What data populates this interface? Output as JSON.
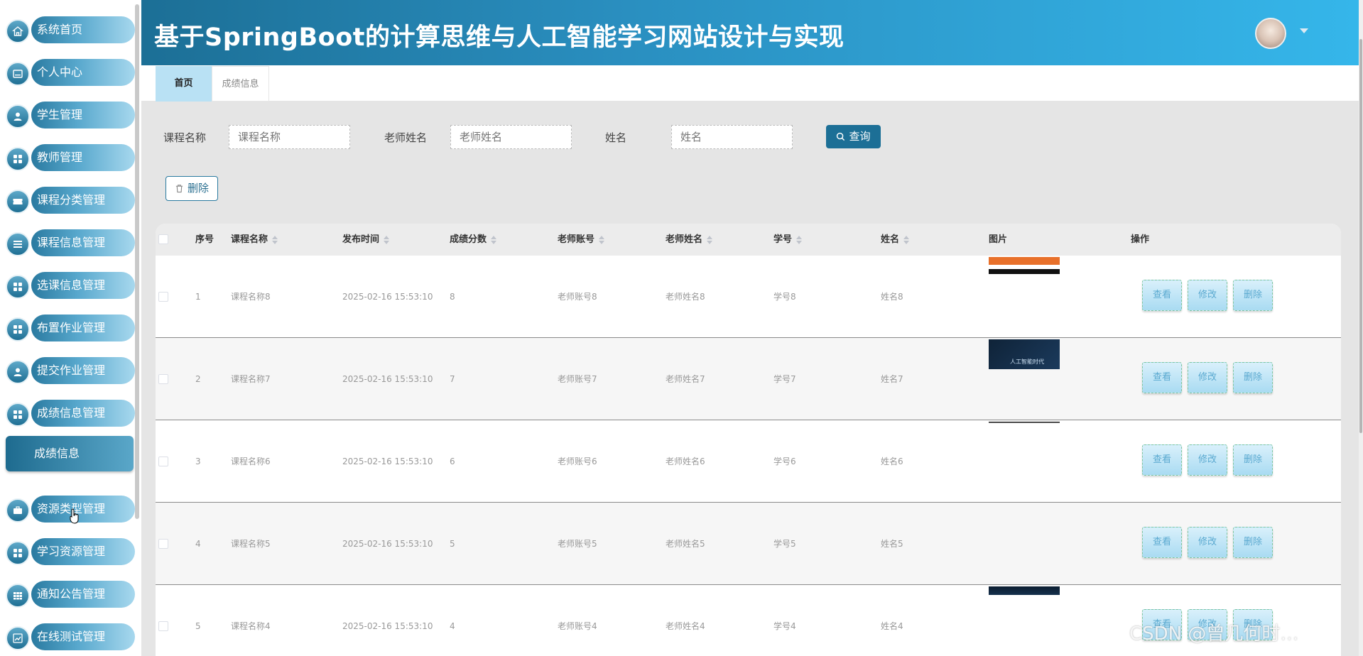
{
  "header": {
    "title": "基于SpringBoot的计算思维与人工智能学习网站设计与实现"
  },
  "sidebar": {
    "items": [
      {
        "label": "系统首页",
        "icon": "home-icon"
      },
      {
        "label": "个人中心",
        "icon": "id-card-icon"
      },
      {
        "label": "学生管理",
        "icon": "user-icon"
      },
      {
        "label": "教师管理",
        "icon": "grid-icon"
      },
      {
        "label": "课程分类管理",
        "icon": "ticket-icon"
      },
      {
        "label": "课程信息管理",
        "icon": "list-icon"
      },
      {
        "label": "选课信息管理",
        "icon": "grid-icon"
      },
      {
        "label": "布置作业管理",
        "icon": "grid-icon"
      },
      {
        "label": "提交作业管理",
        "icon": "user-icon"
      },
      {
        "label": "成绩信息管理",
        "icon": "grid-icon"
      },
      {
        "label": "资源类型管理",
        "icon": "briefcase-icon"
      },
      {
        "label": "学习资源管理",
        "icon": "grid-icon"
      },
      {
        "label": "通知公告管理",
        "icon": "table-icon"
      },
      {
        "label": "在线测试管理",
        "icon": "chart-icon"
      }
    ],
    "submenu_label": "成绩信息"
  },
  "tabs": [
    {
      "label": "首页",
      "active": true
    },
    {
      "label": "成绩信息",
      "active": false
    }
  ],
  "search": {
    "course_label": "课程名称",
    "course_placeholder": "课程名称",
    "teacher_label": "老师姓名",
    "teacher_placeholder": "老师姓名",
    "name_label": "姓名",
    "name_placeholder": "姓名",
    "search_button": "查询"
  },
  "toolbar": {
    "delete_label": "删除"
  },
  "table": {
    "columns": [
      "序号",
      "课程名称",
      "发布时间",
      "成绩分数",
      "老师账号",
      "老师姓名",
      "学号",
      "姓名",
      "图片",
      "操作"
    ],
    "rows": [
      {
        "index": "1",
        "course": "课程名称8",
        "time": "2025-02-16 15:53:10",
        "score": "8",
        "teacher_account": "老师账号8",
        "teacher_name": "老师姓名8",
        "student_no": "学号8",
        "name": "姓名8"
      },
      {
        "index": "2",
        "course": "课程名称7",
        "time": "2025-02-16 15:53:10",
        "score": "7",
        "teacher_account": "老师账号7",
        "teacher_name": "老师姓名7",
        "student_no": "学号7",
        "name": "姓名7"
      },
      {
        "index": "3",
        "course": "课程名称6",
        "time": "2025-02-16 15:53:10",
        "score": "6",
        "teacher_account": "老师账号6",
        "teacher_name": "老师姓名6",
        "student_no": "学号6",
        "name": "姓名6"
      },
      {
        "index": "4",
        "course": "课程名称5",
        "time": "2025-02-16 15:53:10",
        "score": "5",
        "teacher_account": "老师账号5",
        "teacher_name": "老师姓名5",
        "student_no": "学号5",
        "name": "姓名5"
      },
      {
        "index": "5",
        "course": "课程名称4",
        "time": "2025-02-16 15:53:10",
        "score": "4",
        "teacher_account": "老师账号4",
        "teacher_name": "老师姓名4",
        "student_no": "学号4",
        "name": "姓名4"
      }
    ],
    "actions": {
      "view": "查看",
      "edit": "修改",
      "delete": "删除"
    },
    "thumb_caption": "人工智能时代"
  },
  "watermark": "CSDN @曾几何时…",
  "colors": {
    "primary": "#1c6f96",
    "header_end": "#35b6ea",
    "tab_active": "#b9e1f4"
  }
}
